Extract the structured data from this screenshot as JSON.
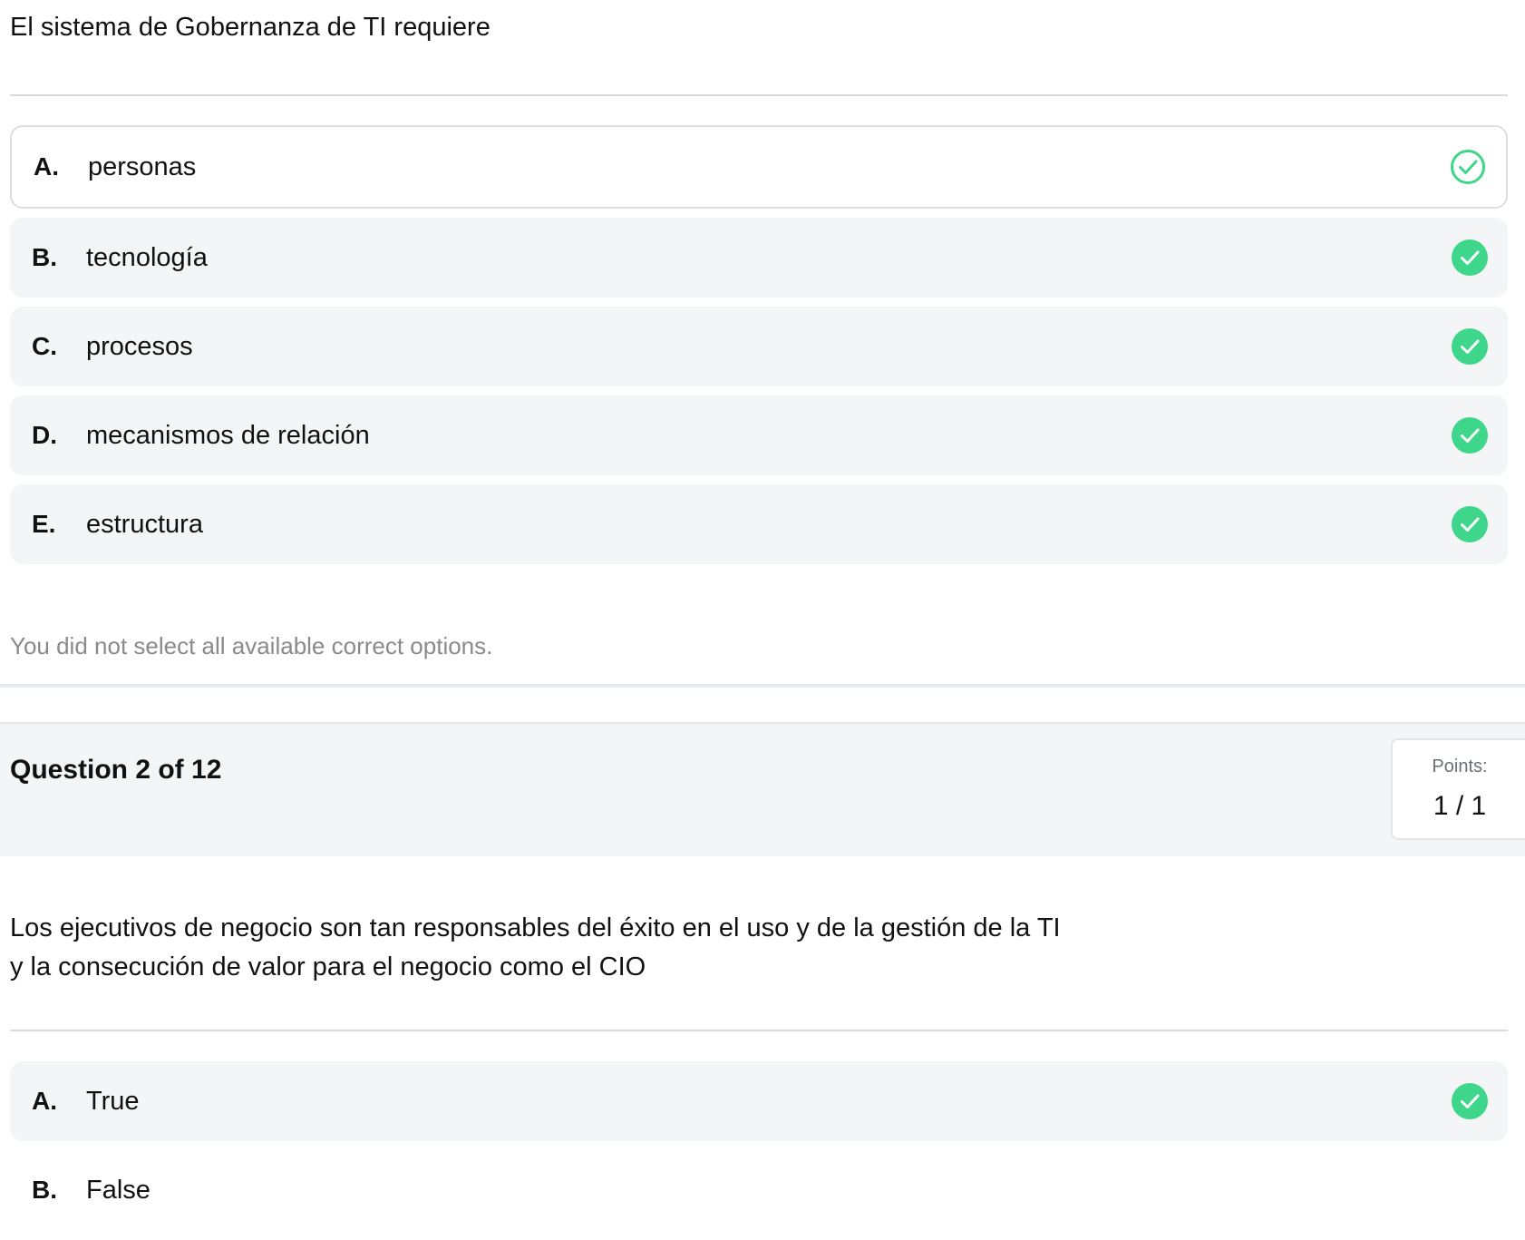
{
  "question1": {
    "prompt": "El sistema de Gobernanza de TI requiere",
    "options": [
      {
        "letter": "A.",
        "text": "personas",
        "status": "correct-unselected"
      },
      {
        "letter": "B.",
        "text": "tecnología",
        "status": "correct-selected"
      },
      {
        "letter": "C.",
        "text": "procesos",
        "status": "correct-selected"
      },
      {
        "letter": "D.",
        "text": "mecanismos de relación",
        "status": "correct-selected"
      },
      {
        "letter": "E.",
        "text": "estructura",
        "status": "correct-selected"
      }
    ],
    "feedback": "You did not select all available correct options."
  },
  "question2": {
    "title": "Question 2 of 12",
    "points_label": "Points:",
    "points_value": "1 / 1",
    "prompt_line1": "Los ejecutivos de negocio son tan responsables del éxito en el uso y de la gestión de la TI",
    "prompt_line2": "y la consecución de valor para el negocio como el CIO",
    "options": [
      {
        "letter": "A.",
        "text": "True",
        "status": "correct-selected"
      },
      {
        "letter": "B.",
        "text": "False",
        "status": "none"
      }
    ]
  },
  "colors": {
    "check_green": "#3ed68a",
    "option_bg": "#f4f5f7",
    "feedback_gray": "#8a8a8a"
  }
}
